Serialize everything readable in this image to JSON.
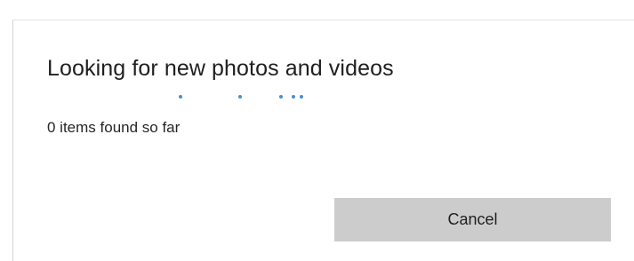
{
  "dialog": {
    "title": "Looking for new photos and videos",
    "status": "0 items found so far",
    "cancel_label": "Cancel"
  },
  "colors": {
    "progress_dot": "#4a8fc9",
    "button_background": "#cccccc"
  }
}
